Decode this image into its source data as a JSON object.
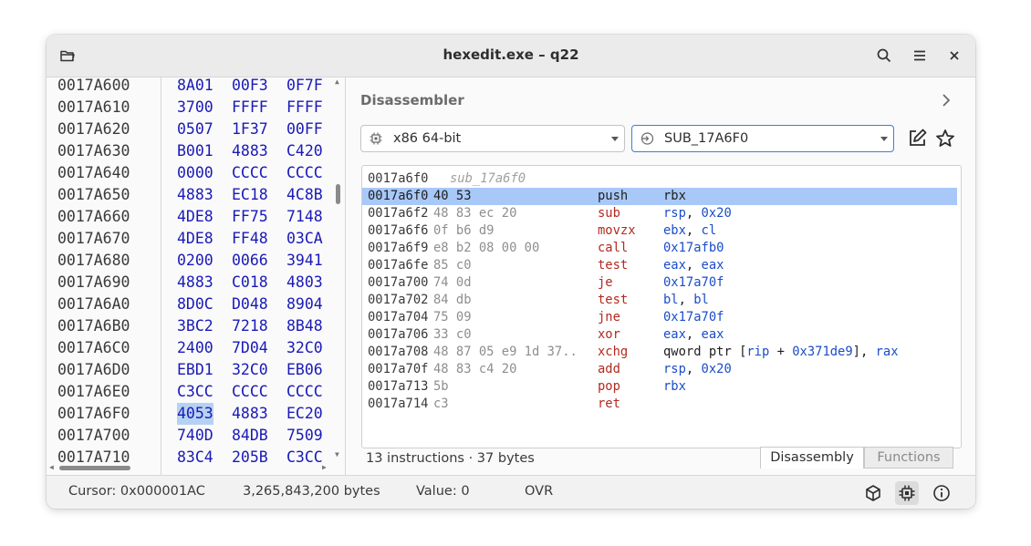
{
  "window": {
    "title": "hexedit.exe – q22",
    "icons": [
      "open-folder-icon",
      "search-icon",
      "menu-icon",
      "close-icon"
    ]
  },
  "hex": {
    "rows": [
      {
        "addr": "0017A600",
        "bytes": [
          "8A01",
          "00F3",
          "0F7F"
        ]
      },
      {
        "addr": "0017A610",
        "bytes": [
          "3700",
          "FFFF",
          "FFFF"
        ]
      },
      {
        "addr": "0017A620",
        "bytes": [
          "0507",
          "1F37",
          "00FF"
        ]
      },
      {
        "addr": "0017A630",
        "bytes": [
          "B001",
          "4883",
          "C420"
        ]
      },
      {
        "addr": "0017A640",
        "bytes": [
          "0000",
          "CCCC",
          "CCCC"
        ]
      },
      {
        "addr": "0017A650",
        "bytes": [
          "4883",
          "EC18",
          "4C8B"
        ]
      },
      {
        "addr": "0017A660",
        "bytes": [
          "4DE8",
          "FF75",
          "7148"
        ]
      },
      {
        "addr": "0017A670",
        "bytes": [
          "4DE8",
          "FF48",
          "03CA"
        ]
      },
      {
        "addr": "0017A680",
        "bytes": [
          "0200",
          "0066",
          "3941"
        ]
      },
      {
        "addr": "0017A690",
        "bytes": [
          "4883",
          "C018",
          "4803"
        ]
      },
      {
        "addr": "0017A6A0",
        "bytes": [
          "8D0C",
          "D048",
          "8904"
        ]
      },
      {
        "addr": "0017A6B0",
        "bytes": [
          "3BC2",
          "7218",
          "8B48"
        ]
      },
      {
        "addr": "0017A6C0",
        "bytes": [
          "2400",
          "7D04",
          "32C0"
        ]
      },
      {
        "addr": "0017A6D0",
        "bytes": [
          "EBD1",
          "32C0",
          "EB06"
        ]
      },
      {
        "addr": "0017A6E0",
        "bytes": [
          "C3CC",
          "CCCC",
          "CCCC"
        ]
      },
      {
        "addr": "0017A6F0",
        "bytes": [
          "4053",
          "4883",
          "EC20"
        ]
      },
      {
        "addr": "0017A700",
        "bytes": [
          "740D",
          "84DB",
          "7509"
        ]
      },
      {
        "addr": "0017A710",
        "bytes": [
          "83C4",
          "205B",
          "C3CC"
        ]
      }
    ]
  },
  "disassembler": {
    "title": "Disassembler",
    "arch_label": "x86 64-bit",
    "function_label": "SUB_17A6F0",
    "header_addr": "0017a6f0",
    "header_label": "sub_17a6f0",
    "lines": [
      {
        "addr": "0017a6f0",
        "bytes": "40 53",
        "mn": "push",
        "ops": [
          {
            "t": "rbx",
            "k": "plain"
          }
        ]
      },
      {
        "addr": "0017a6f2",
        "bytes": "48 83 ec 20",
        "mn": "sub",
        "ops": [
          {
            "t": "rsp",
            "k": "reg"
          },
          {
            "t": ", ",
            "k": "plain"
          },
          {
            "t": "0x20",
            "k": "num"
          }
        ]
      },
      {
        "addr": "0017a6f6",
        "bytes": "0f b6 d9",
        "mn": "movzx",
        "ops": [
          {
            "t": "ebx",
            "k": "reg"
          },
          {
            "t": ", ",
            "k": "plain"
          },
          {
            "t": "cl",
            "k": "reg"
          }
        ]
      },
      {
        "addr": "0017a6f9",
        "bytes": "e8 b2 08 00 00",
        "mn": "call",
        "ops": [
          {
            "t": "0x17afb0",
            "k": "num"
          }
        ]
      },
      {
        "addr": "0017a6fe",
        "bytes": "85 c0",
        "mn": "test",
        "ops": [
          {
            "t": "eax",
            "k": "reg"
          },
          {
            "t": ", ",
            "k": "plain"
          },
          {
            "t": "eax",
            "k": "reg"
          }
        ]
      },
      {
        "addr": "0017a700",
        "bytes": "74 0d",
        "mn": "je",
        "ops": [
          {
            "t": "0x17a70f",
            "k": "num"
          }
        ]
      },
      {
        "addr": "0017a702",
        "bytes": "84 db",
        "mn": "test",
        "ops": [
          {
            "t": "bl",
            "k": "reg"
          },
          {
            "t": ", ",
            "k": "plain"
          },
          {
            "t": "bl",
            "k": "reg"
          }
        ]
      },
      {
        "addr": "0017a704",
        "bytes": "75 09",
        "mn": "jne",
        "ops": [
          {
            "t": "0x17a70f",
            "k": "num"
          }
        ]
      },
      {
        "addr": "0017a706",
        "bytes": "33 c0",
        "mn": "xor",
        "ops": [
          {
            "t": "eax",
            "k": "reg"
          },
          {
            "t": ", ",
            "k": "plain"
          },
          {
            "t": "eax",
            "k": "reg"
          }
        ]
      },
      {
        "addr": "0017a708",
        "bytes": "48 87 05 e9 1d 37..",
        "mn": "xchg",
        "ops": [
          {
            "t": "qword ptr [",
            "k": "plain"
          },
          {
            "t": "rip",
            "k": "reg"
          },
          {
            "t": " + ",
            "k": "plain"
          },
          {
            "t": "0x371de9",
            "k": "num"
          },
          {
            "t": "], ",
            "k": "plain"
          },
          {
            "t": "rax",
            "k": "reg"
          }
        ]
      },
      {
        "addr": "0017a70f",
        "bytes": "48 83 c4 20",
        "mn": "add",
        "ops": [
          {
            "t": "rsp",
            "k": "reg"
          },
          {
            "t": ", ",
            "k": "plain"
          },
          {
            "t": "0x20",
            "k": "num"
          }
        ]
      },
      {
        "addr": "0017a713",
        "bytes": "5b",
        "mn": "pop",
        "ops": [
          {
            "t": "rbx",
            "k": "reg"
          }
        ]
      },
      {
        "addr": "0017a714",
        "bytes": "c3",
        "mn": "ret",
        "ops": []
      }
    ],
    "summary": "13 instructions · 37 bytes",
    "tabs": [
      "Disassembly",
      "Functions"
    ]
  },
  "status": {
    "cursor": "Cursor: 0x000001AC",
    "size": "3,265,843,200 bytes",
    "value": "Value: 0",
    "mode": "OVR",
    "icons": [
      "cube-icon",
      "chip-icon",
      "info-icon"
    ]
  }
}
